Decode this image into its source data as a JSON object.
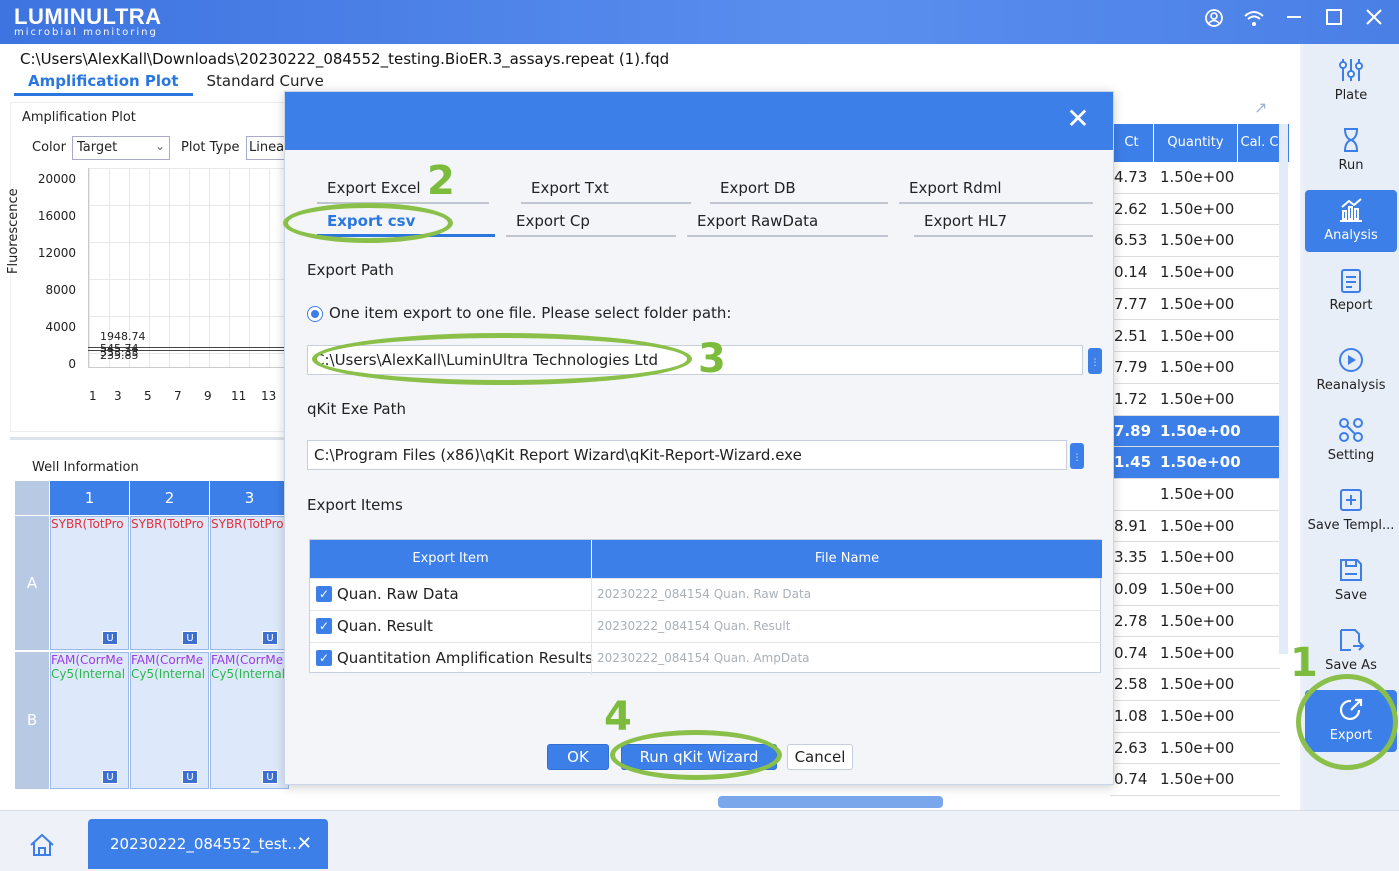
{
  "app": {
    "logo": "LUMINULTRA",
    "logo_sub": "microbial monitoring",
    "file_path": "C:\\Users\\AlexKall\\Downloads\\20230222_084552_testing.BioER.3_assays.repeat (1).fqd"
  },
  "main_tabs": [
    {
      "label": "Amplification Plot",
      "active": true
    },
    {
      "label": "Standard Curve",
      "active": false
    }
  ],
  "plot": {
    "title": "Amplification Plot",
    "color_label": "Color",
    "color_value": "Target",
    "plot_type_label": "Plot Type",
    "plot_type_value": "Linear",
    "y_axis_label": "Fluorescence",
    "y_ticks": [
      "20000",
      "16000",
      "12000",
      "8000",
      "4000",
      "0"
    ],
    "x_ticks": [
      "1",
      "3",
      "5",
      "7",
      "9",
      "11",
      "13"
    ],
    "annotations": [
      "1948.74",
      "545.74",
      "333.33",
      "235.85"
    ]
  },
  "well_info": {
    "title": "Well Information",
    "columns": [
      "1",
      "2",
      "3"
    ],
    "rows": [
      "A",
      "B"
    ],
    "row_a_text": "SYBR(TotPro",
    "row_b_text1": "FAM(CorrMe",
    "row_b_text2": "Cy5(Internal",
    "badge": "U"
  },
  "right_table": {
    "headers": [
      "Ct",
      "Quantity",
      "Cal. Co"
    ],
    "rows": [
      {
        "ct": "4.73",
        "qty": "1.50e+00",
        "hl": false
      },
      {
        "ct": "2.62",
        "qty": "1.50e+00",
        "hl": false
      },
      {
        "ct": "6.53",
        "qty": "1.50e+00",
        "hl": false
      },
      {
        "ct": "0.14",
        "qty": "1.50e+00",
        "hl": false
      },
      {
        "ct": "7.77",
        "qty": "1.50e+00",
        "hl": false
      },
      {
        "ct": "2.51",
        "qty": "1.50e+00",
        "hl": false
      },
      {
        "ct": "7.79",
        "qty": "1.50e+00",
        "hl": false
      },
      {
        "ct": "1.72",
        "qty": "1.50e+00",
        "hl": false
      },
      {
        "ct": "7.89",
        "qty": "1.50e+00",
        "hl": true
      },
      {
        "ct": "1.45",
        "qty": "1.50e+00",
        "hl": true
      },
      {
        "ct": "",
        "qty": "1.50e+00",
        "hl": false
      },
      {
        "ct": "8.91",
        "qty": "1.50e+00",
        "hl": false
      },
      {
        "ct": "3.35",
        "qty": "1.50e+00",
        "hl": false
      },
      {
        "ct": "0.09",
        "qty": "1.50e+00",
        "hl": false
      },
      {
        "ct": "2.78",
        "qty": "1.50e+00",
        "hl": false
      },
      {
        "ct": "0.74",
        "qty": "1.50e+00",
        "hl": false
      },
      {
        "ct": "2.58",
        "qty": "1.50e+00",
        "hl": false
      },
      {
        "ct": "1.08",
        "qty": "1.50e+00",
        "hl": false
      },
      {
        "ct": "2.63",
        "qty": "1.50e+00",
        "hl": false
      },
      {
        "ct": "0.74",
        "qty": "1.50e+00",
        "hl": false
      }
    ]
  },
  "sidenav": [
    {
      "label": "Plate",
      "icon": "sliders-icon"
    },
    {
      "label": "Run",
      "icon": "hourglass-icon"
    },
    {
      "label": "Analysis",
      "icon": "chart-icon",
      "active": true
    },
    {
      "label": "Report",
      "icon": "report-icon"
    },
    {
      "label": "Reanalysis",
      "icon": "play-icon"
    },
    {
      "label": "Setting",
      "icon": "settings-icon"
    },
    {
      "label": "Save Templ...",
      "icon": "save-template-icon"
    },
    {
      "label": "Save",
      "icon": "save-icon"
    },
    {
      "label": "Save As",
      "icon": "save-as-icon"
    },
    {
      "label": "Export",
      "icon": "export-icon",
      "active": true
    }
  ],
  "taskbar": {
    "doc_tab": "20230222_084552_test..."
  },
  "dialog": {
    "tabs_row1": [
      "Export Excel",
      "Export Txt",
      "Export DB",
      "Export Rdml"
    ],
    "tabs_row2": [
      "Export csv",
      "Export Cp",
      "Export RawData",
      "Export HL7"
    ],
    "export_path_label": "Export Path",
    "radio_label": "One item export to one file. Please select folder path:",
    "export_path_value": "C:\\Users\\AlexKall\\LuminUltra Technologies Ltd",
    "qkit_label": "qKit Exe Path",
    "qkit_path_value": "C:\\Program Files (x86)\\qKit Report Wizard\\qKit-Report-Wizard.exe",
    "export_items_label": "Export Items",
    "table_headers": [
      "Export Item",
      "File Name"
    ],
    "items": [
      {
        "name": "Quan. Raw Data",
        "file": "20230222_084154 Quan. Raw Data"
      },
      {
        "name": "Quan. Result",
        "file": "20230222_084154 Quan. Result"
      },
      {
        "name": "Quantitation Amplification Results",
        "file": "20230222_084154 Quan. AmpData"
      }
    ],
    "ok_label": "OK",
    "run_label": "Run qKit Wizard",
    "cancel_label": "Cancel"
  },
  "annotations": {
    "step1": "1",
    "step2": "2",
    "step3": "3",
    "step4": "4",
    "ring_color": "#8ac04a"
  }
}
